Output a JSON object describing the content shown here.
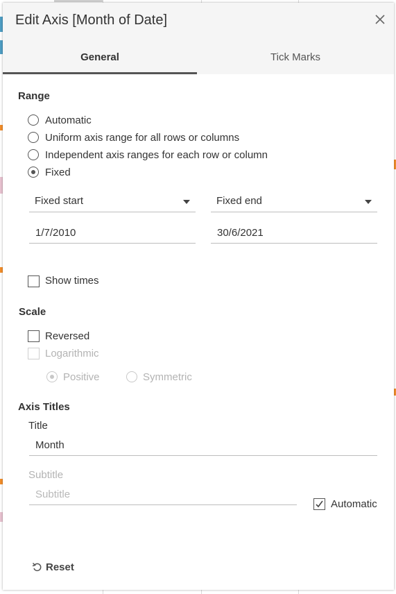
{
  "dialog": {
    "title": "Edit Axis [Month of Date]"
  },
  "tabs": [
    {
      "label": "General",
      "active": true
    },
    {
      "label": "Tick Marks",
      "active": false
    }
  ],
  "range": {
    "title": "Range",
    "options": [
      {
        "label": "Automatic",
        "checked": false
      },
      {
        "label": "Uniform axis range for all rows or columns",
        "checked": false
      },
      {
        "label": "Independent axis ranges for each row or column",
        "checked": false
      },
      {
        "label": "Fixed",
        "checked": true
      }
    ],
    "start_select": "Fixed start",
    "end_select": "Fixed end",
    "start_value": "1/7/2010",
    "end_value": "30/6/2021",
    "show_times": {
      "label": "Show times",
      "checked": false
    }
  },
  "scale": {
    "title": "Scale",
    "reversed": {
      "label": "Reversed",
      "checked": false
    },
    "logarithmic": {
      "label": "Logarithmic",
      "checked": false,
      "disabled": true
    },
    "positive": {
      "label": "Positive",
      "checked": true,
      "disabled": true
    },
    "symmetric": {
      "label": "Symmetric",
      "checked": false,
      "disabled": true
    }
  },
  "axis_titles": {
    "title": "Axis Titles",
    "title_label": "Title",
    "title_value": "Month",
    "subtitle_label": "Subtitle",
    "subtitle_placeholder": "Subtitle",
    "automatic": {
      "label": "Automatic",
      "checked": true
    }
  },
  "footer": {
    "reset_label": "Reset"
  },
  "colors": {
    "header_bg": "#f5f5f5",
    "active_tab_underline": "#555555",
    "disabled_text": "#b3b3b3"
  }
}
